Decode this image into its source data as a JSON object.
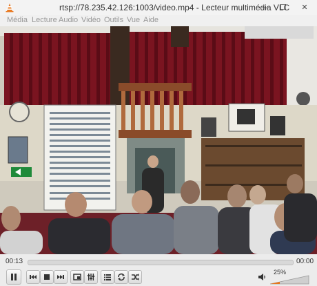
{
  "window": {
    "title": "rtsp://78.235.42.126:1003/video.mp4 - Lecteur multimédia VLC",
    "minimize": "—",
    "maximize": "☐",
    "close": "✕"
  },
  "menu": [
    {
      "label": "Média"
    },
    {
      "label": "Lecture"
    },
    {
      "label": "Audio"
    },
    {
      "label": "Vidéo"
    },
    {
      "label": "Outils"
    },
    {
      "label": "Vue"
    },
    {
      "label": "Aide"
    }
  ],
  "playback": {
    "elapsed": "00:13",
    "total": "00:00",
    "volume_label": "25%",
    "volume_level": 0.25
  },
  "colors": {
    "accent": "#e8761b",
    "curtain": "#7a1420"
  },
  "icons": [
    "vlc-cone-icon",
    "pause-icon",
    "previous-icon",
    "stop-icon",
    "next-icon",
    "fullscreen-icon",
    "extended-settings-icon",
    "playlist-icon",
    "loop-icon",
    "shuffle-icon",
    "volume-icon"
  ]
}
